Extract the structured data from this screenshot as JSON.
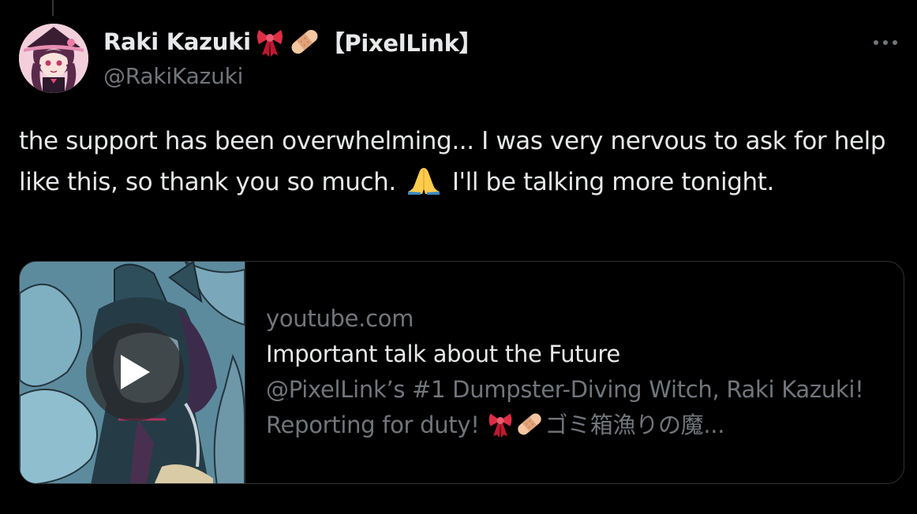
{
  "tweet": {
    "author": {
      "display_name": "Raki Kazuki",
      "name_emojis": [
        "ribbon-emoji",
        "bandage-emoji"
      ],
      "affiliation": "【PixelLink】",
      "handle": "@RakiKazuki"
    },
    "menu_icon": "more-horizontal-icon",
    "text_part1": "the support has been overwhelming... I was very nervous to ask for help like this, so thank you so much.",
    "text_emoji": "folded-hands-emoji",
    "text_part2": "I'll be talking more tonight.",
    "card": {
      "domain": "youtube.com",
      "title": "Important talk about the Future",
      "description_part1": "@PixelLink’s #1 Dumpster-Diving Witch, Raki Kazuki! Reporting for duty!",
      "description_emojis": [
        "ribbon-emoji",
        "bandage-emoji"
      ],
      "description_part2": "ゴミ箱漁りの魔...",
      "play_icon": "play-icon"
    }
  },
  "colors": {
    "background": "#000000",
    "text_primary": "#e7e9ea",
    "text_secondary": "#71767b",
    "border": "#2f3336"
  }
}
